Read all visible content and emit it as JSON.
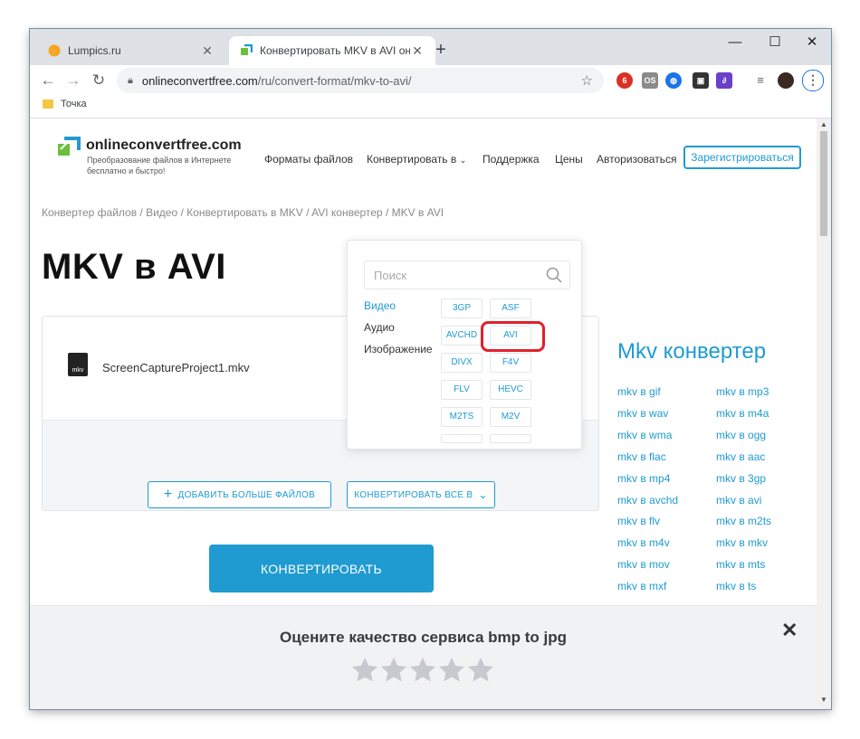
{
  "browser": {
    "tabs": [
      {
        "title": "Lumpics.ru",
        "active": false
      },
      {
        "title": "Конвертировать MKV в AVI онлайн",
        "active": true
      }
    ],
    "new_tab_symbol": "+",
    "window_controls": {
      "minimize": "—",
      "maximize": "☐",
      "close": "✕"
    },
    "url_host": "onlineconvertfree.com",
    "url_path": "/ru/convert-format/mkv-to-avi/",
    "bookmark": "Точка"
  },
  "site": {
    "logo": "onlineconvertfree.com",
    "tagline": "Преобразование файлов в Интернете бесплатно и быстро!",
    "nav": {
      "formats": "Форматы файлов",
      "convert": "Конвертировать в",
      "support": "Поддержка",
      "prices": "Цены",
      "login": "Авторизоваться",
      "register": "Зарегистрироваться"
    },
    "breadcrumb": "Конвертер файлов / Видео / Конвертировать в MKV / AVI конвертер / MKV в AVI",
    "page_title": "MKV в AVI",
    "file": {
      "icon_label": "mkv",
      "name": "ScreenCaptureProject1.mkv"
    },
    "add_files": "ДОБАВИТЬ БОЛЬШЕ ФАЙЛОВ",
    "convert_all": "КОНВЕРТИРОВАТЬ ВСЕ В",
    "convert": "КОНВЕРТИРОВАТЬ"
  },
  "dropdown": {
    "search_placeholder": "Поиск",
    "categories": [
      "Видео",
      "Аудио",
      "Изображение"
    ],
    "active_category": "Видео",
    "formats": [
      "3GP",
      "ASF",
      "AVCHD",
      "AVI",
      "DIVX",
      "F4V",
      "FLV",
      "HEVC",
      "M2TS",
      "M2V"
    ],
    "selected_format": "AVI"
  },
  "sidebar": {
    "title": "Mkv конвертер",
    "links_left": [
      "mkv в gif",
      "mkv в wav",
      "mkv в wma",
      "mkv в flac",
      "mkv в mp4",
      "mkv в avchd",
      "mkv в flv",
      "mkv в m4v",
      "mkv в mov",
      "mkv в mxf"
    ],
    "links_right": [
      "mkv в mp3",
      "mkv в m4a",
      "mkv в ogg",
      "mkv в aac",
      "mkv в 3gp",
      "mkv в avi",
      "mkv в m2ts",
      "mkv в mkv",
      "mkv в mts",
      "mkv в ts"
    ]
  },
  "rating": {
    "question": "Оцените качество сервиса bmp to jpg",
    "close": "✕",
    "stars": 5
  },
  "colors": {
    "accent": "#1f9bd1",
    "highlight": "#e0212d"
  }
}
